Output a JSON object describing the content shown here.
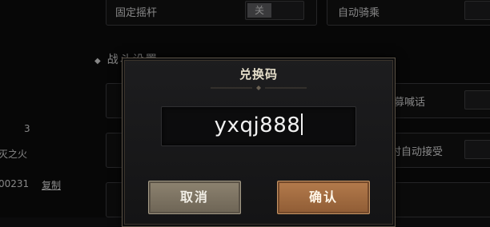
{
  "background": {
    "settings": {
      "fixed_joystick_label": "固定摇杆",
      "fixed_joystick_value": "关",
      "auto_ride_label": "自动骑乘",
      "battle_section_title": "战斗设置",
      "recruit_shout_partial": "募喊话",
      "auto_accept_partial": "时自动接受"
    },
    "left_panel": {
      "count": "3",
      "name_partial": "灭之火",
      "id_partial": "00231",
      "copy_label": "复制"
    }
  },
  "dialog": {
    "title": "兑换码",
    "code_value": "yxqj888",
    "cancel_label": "取消",
    "confirm_label": "确认"
  },
  "colors": {
    "dialog_border": "#5c5347",
    "cancel_button": "#7d7463",
    "confirm_button": "#a46c42"
  }
}
